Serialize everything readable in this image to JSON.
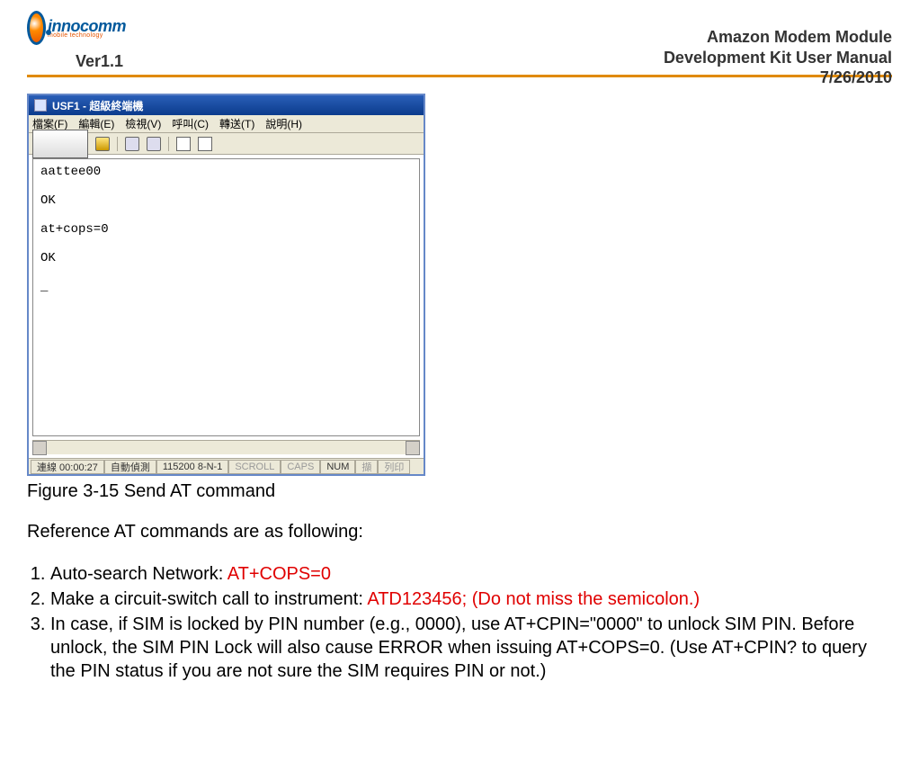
{
  "logo": {
    "word": "innocomm",
    "sub": "mobile technology"
  },
  "header": {
    "title1": "Amazon Modem Module",
    "title2": "Development Kit User Manual",
    "version": "Ver1.1",
    "date": "7/26/2010"
  },
  "screenshot": {
    "window_title": "USF1 - 超級終端機",
    "menus": {
      "file": "檔案(F)",
      "edit": "編輯(E)",
      "view": "檢視(V)",
      "call": "呼叫(C)",
      "transfer": "轉送(T)",
      "help": "說明(H)"
    },
    "body_text": "aattee00\n\nOK\n\nat+cops=0\n\nOK\n\n_",
    "status": {
      "conn": "連線 00:00:27",
      "auto": "自動偵測",
      "baud": "115200 8-N-1",
      "scroll": "SCROLL",
      "caps": "CAPS",
      "num": "NUM",
      "cap": "擷",
      "print": "列印"
    }
  },
  "caption": "Figure 3-15 Send AT command",
  "reference_line": "Reference AT commands are as following:",
  "items": {
    "i1_pre": "Auto-search Network:  ",
    "i1_red": "AT+COPS=0",
    "i2_pre": "Make a circuit-switch call to instrument:  ",
    "i2_red": "ATD123456;    (Do not miss the semicolon.)",
    "i3": "In case, if SIM is locked by PIN number (e.g., 0000), use AT+CPIN=\"0000\" to unlock SIM PIN. Before unlock, the SIM PIN Lock will also cause ERROR when issuing AT+COPS=0. (Use AT+CPIN? to query the PIN status if you are not sure the SIM requires PIN or not.)"
  }
}
